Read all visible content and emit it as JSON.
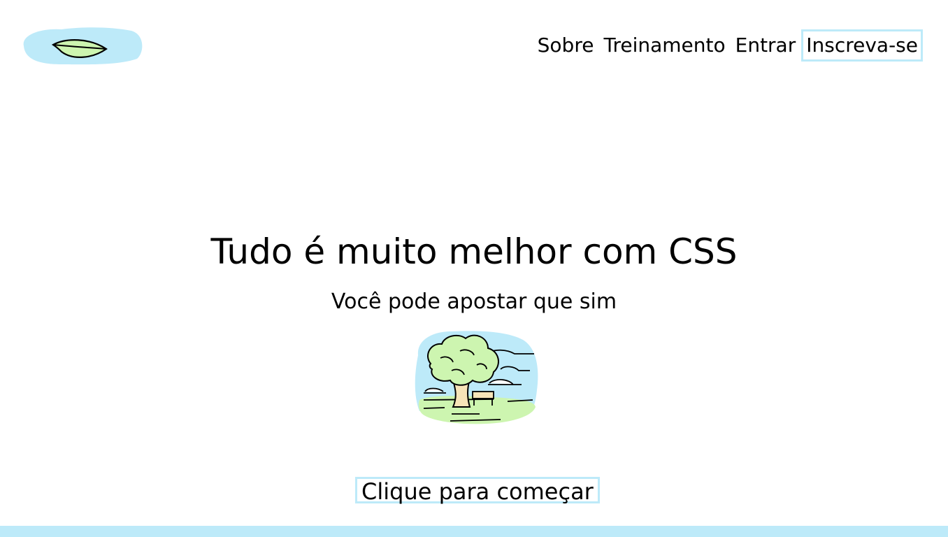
{
  "nav": {
    "items": [
      {
        "label": "Sobre"
      },
      {
        "label": "Treinamento"
      },
      {
        "label": "Entrar"
      },
      {
        "label": "Inscreva-se"
      }
    ]
  },
  "hero": {
    "title": "Tudo é muito melhor com CSS",
    "subtitle": "Você pode apostar que sim",
    "cta_label": "Clique para começar"
  },
  "icons": {
    "logo": "leaf-icon",
    "illustration": "tree-landscape-icon"
  },
  "colors": {
    "accent": "#bdeaf9",
    "leaf": "#cdf5b0",
    "trunk": "#f7e4b8"
  }
}
